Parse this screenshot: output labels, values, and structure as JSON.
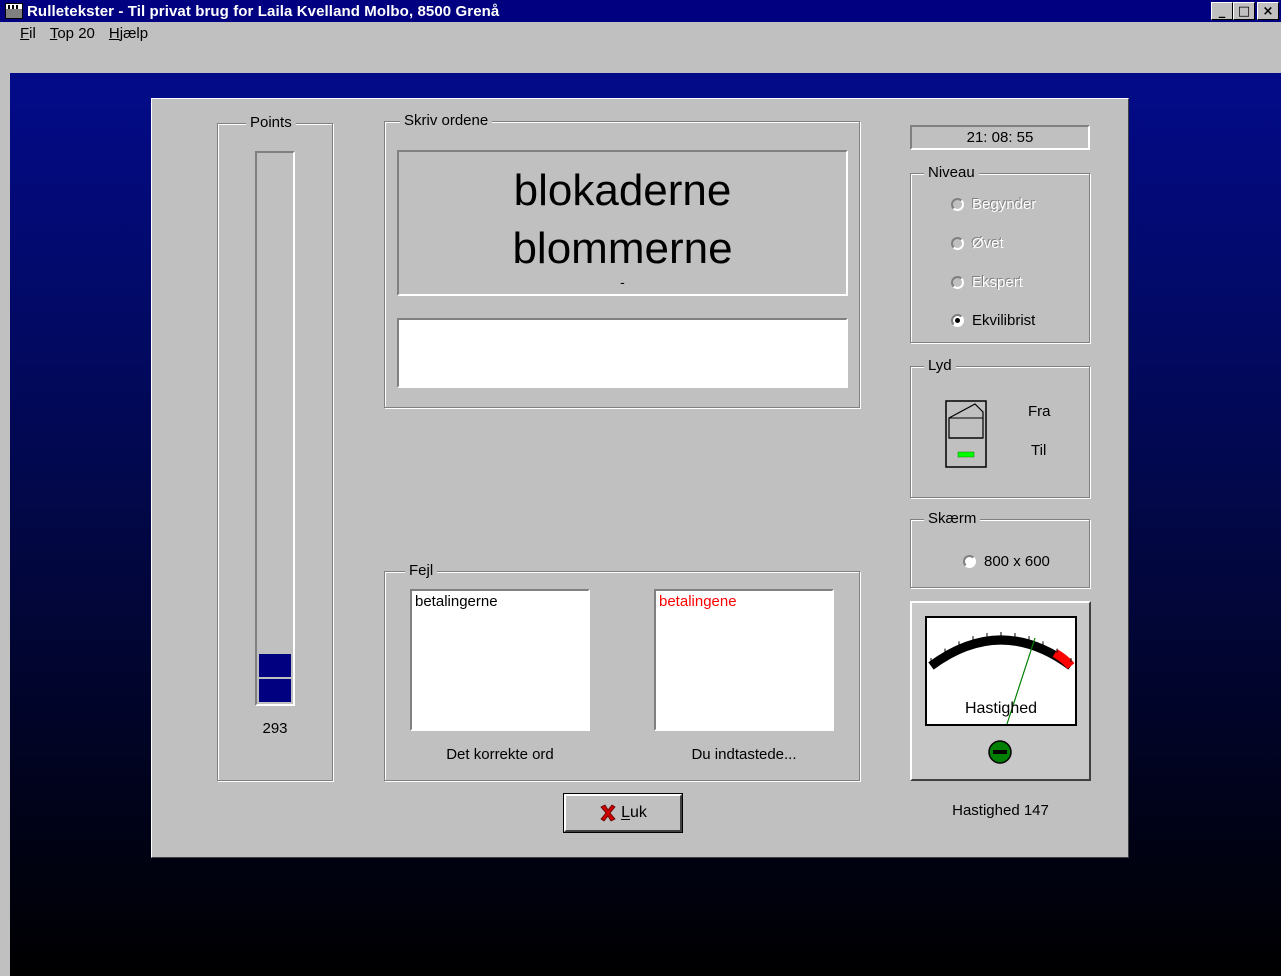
{
  "window": {
    "title": "Rulletekster - Til privat brug for  Laila Kvelland Molbo,  8500  Grenå",
    "minimize_glyph": "_",
    "maximize_glyph": "□",
    "close_glyph": "×"
  },
  "menu": {
    "items": [
      {
        "label": "Fil"
      },
      {
        "label": "Top 20"
      },
      {
        "label": "Hjælp"
      }
    ]
  },
  "points": {
    "legend": "Points",
    "value": "293"
  },
  "skriv": {
    "legend": "Skriv ordene",
    "word1": "blokaderne",
    "word2": "blommerne",
    "word3": "-",
    "input_value": ""
  },
  "clock": "21: 08: 55",
  "niveau": {
    "legend": "Niveau",
    "options": [
      {
        "label": "Begynder",
        "enabled": false,
        "checked": false
      },
      {
        "label": "Øvet",
        "enabled": false,
        "checked": false
      },
      {
        "label": "Ekspert",
        "enabled": false,
        "checked": false
      },
      {
        "label": "Ekvilibrist",
        "enabled": true,
        "checked": true
      }
    ]
  },
  "lyd": {
    "legend": "Lyd",
    "fra": "Fra",
    "til": "Til",
    "state": "Til"
  },
  "skaerm": {
    "legend": "Skærm",
    "option": "800 x 600"
  },
  "meter": {
    "label": "Hastighed",
    "value_text": "Hastighed 147",
    "value": 147
  },
  "fejl": {
    "legend": "Fejl",
    "correct_list": [
      "betalingerne"
    ],
    "typed_list": [
      "betalingene"
    ],
    "correct_caption": "Det korrekte ord",
    "typed_caption": "Du indtastede..."
  },
  "close_button": {
    "label": "Luk",
    "icon": "x-icon"
  },
  "colors": {
    "title_bar": "#000080",
    "error_text": "#ff0000",
    "bar_fill": "#000080",
    "led_green": "#00ff00"
  }
}
